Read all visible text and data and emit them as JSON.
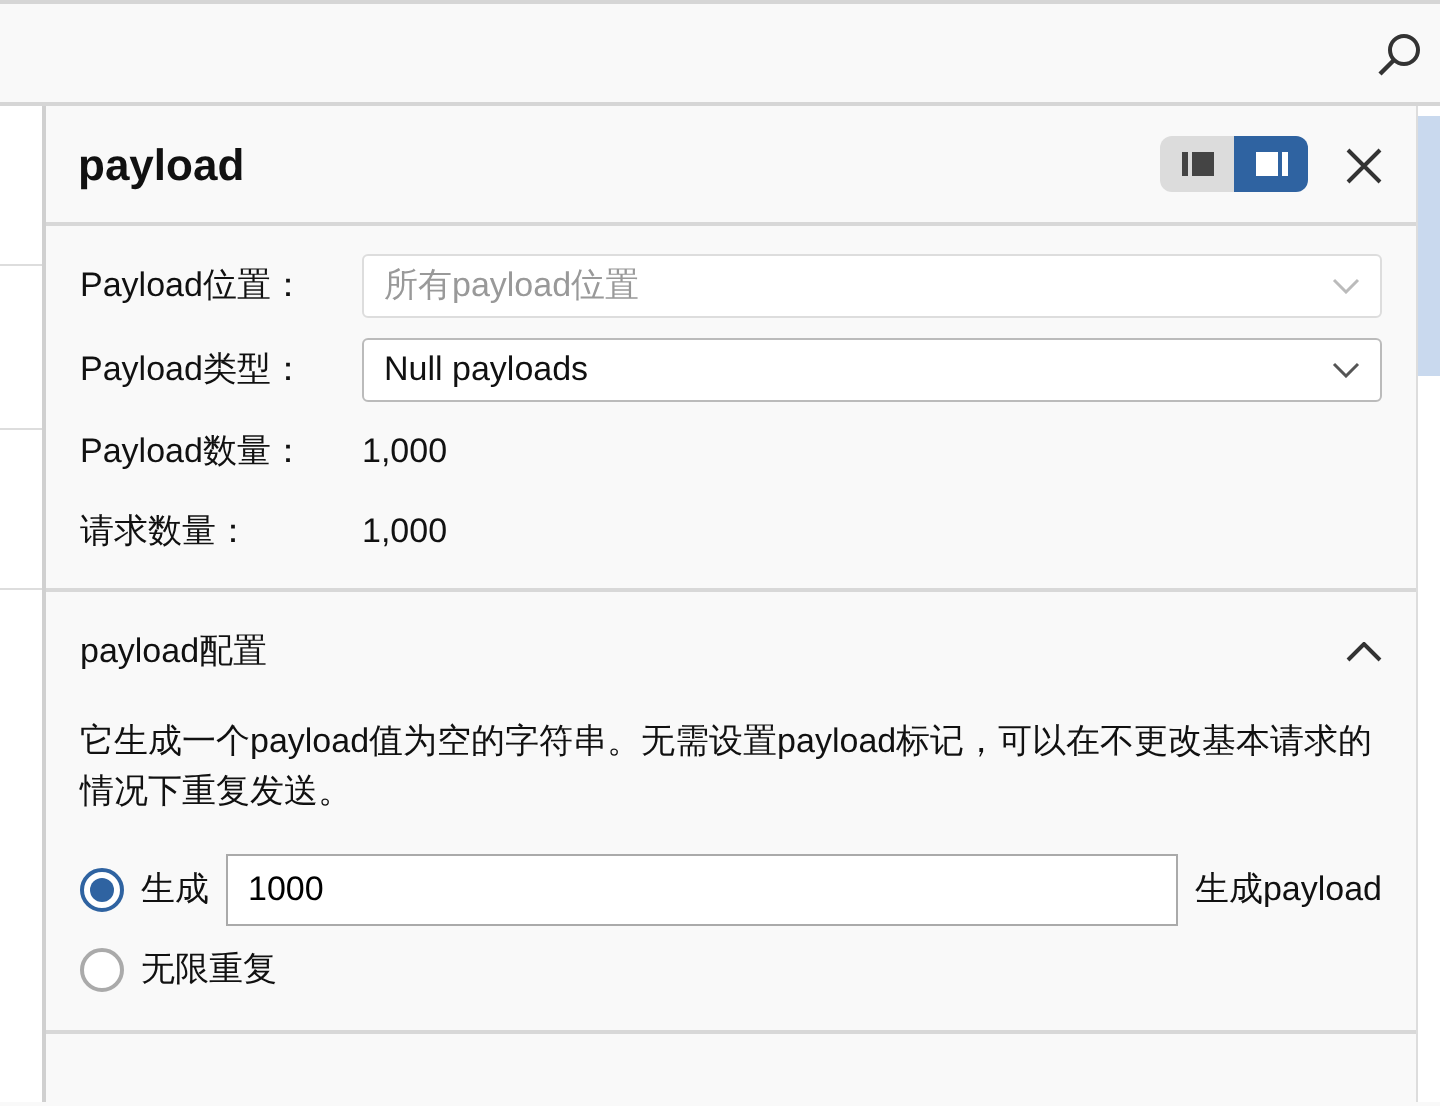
{
  "panel": {
    "title": "payload",
    "layout_toggle": [
      {
        "selected": false
      },
      {
        "selected": true
      }
    ],
    "fields": [
      {
        "kind": "select",
        "label": "Payload位置：",
        "value": "所有payload位置",
        "disabled": true
      },
      {
        "kind": "select",
        "label": "Payload类型：",
        "value": "Null payloads",
        "disabled": false
      },
      {
        "kind": "text",
        "label": "Payload数量：",
        "value": "1,000"
      },
      {
        "kind": "text",
        "label": "请求数量：",
        "value": "1,000"
      }
    ],
    "section": {
      "title": "payload配置",
      "expanded": true,
      "description": "它生成一个payload值为空的字符串。无需设置payload标记，可以在不更改基本请求的情况下重复发送。",
      "options": [
        {
          "label": "生成",
          "selected": true,
          "value": "1000",
          "suffix": "生成payload"
        },
        {
          "label": "无限重复",
          "selected": false
        }
      ]
    }
  }
}
